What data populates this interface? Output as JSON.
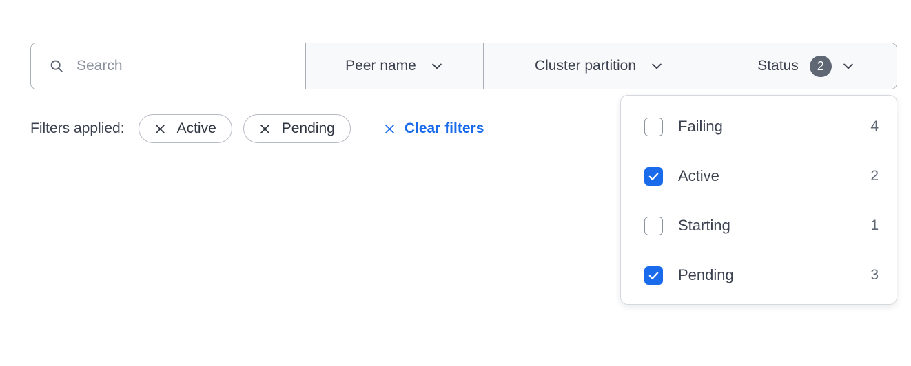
{
  "colors": {
    "accent_blue": "#1a6aec",
    "badge_gray": "#5f6775",
    "text_primary": "#3c4250",
    "placeholder": "#8a909d",
    "border": "#a9aeb9",
    "segment_bg": "#f8f9fa"
  },
  "filter_bar": {
    "search": {
      "icon": "search-icon",
      "value": "",
      "placeholder": "Search"
    },
    "dropdowns": [
      {
        "label": "Peer name",
        "icon": "chevron-down-icon",
        "badge": null
      },
      {
        "label": "Cluster partition",
        "icon": "chevron-down-icon",
        "badge": null
      },
      {
        "label": "Status",
        "icon": "chevron-down-icon",
        "badge": "2"
      }
    ]
  },
  "applied_filters": {
    "label": "Filters applied:",
    "chips": [
      {
        "label": "Active",
        "remove_icon": "close-icon"
      },
      {
        "label": "Pending",
        "remove_icon": "close-icon"
      }
    ],
    "clear": {
      "label": "Clear filters",
      "icon": "close-icon"
    }
  },
  "status_dropdown": {
    "open": true,
    "options": [
      {
        "label": "Failing",
        "count": "4",
        "checked": false
      },
      {
        "label": "Active",
        "count": "2",
        "checked": true
      },
      {
        "label": "Starting",
        "count": "1",
        "checked": false
      },
      {
        "label": "Pending",
        "count": "3",
        "checked": true
      }
    ]
  }
}
